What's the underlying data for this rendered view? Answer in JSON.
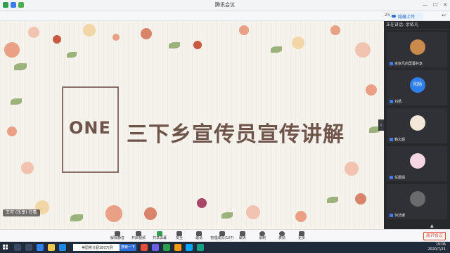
{
  "window": {
    "title": "腾讯会议"
  },
  "subbar": {
    "time": "25:08",
    "cloud_label": "隐藏上传"
  },
  "slide": {
    "title_en": "ONE",
    "title_cn": "三下乡宣传员宣传讲解",
    "speaker_tag": "王可 (乐享) 在看"
  },
  "panel": {
    "header": "正在讲话: 余依凡",
    "participants": [
      {
        "name": "余依凡的屏幕共享"
      },
      {
        "name": "阳扬",
        "avatar_text": "阳扬"
      },
      {
        "name": "刘扬"
      },
      {
        "name": "韩文超"
      },
      {
        "name": "任震娟"
      },
      {
        "name": "何法娜"
      }
    ],
    "collapse": "▲"
  },
  "toolbar": {
    "buttons": [
      {
        "label": "解除静音",
        "icon": "mic-icon"
      },
      {
        "label": "开启视频",
        "icon": "video-icon"
      },
      {
        "label": "共享屏幕",
        "icon": "share-screen-icon"
      },
      {
        "label": "安全",
        "icon": "shield-icon"
      },
      {
        "label": "邀请",
        "icon": "invite-icon"
      },
      {
        "label": "管理成员(107)",
        "icon": "members-icon"
      },
      {
        "label": "聊天",
        "icon": "chat-icon"
      },
      {
        "label": "录制",
        "icon": "record-icon"
      },
      {
        "label": "表情",
        "icon": "emoji-icon"
      },
      {
        "label": "更多",
        "icon": "more-icon"
      }
    ],
    "leave_label": "离开会议"
  },
  "taskbar": {
    "search_text": "美国累计超380万例",
    "search_button": "搜索一下",
    "time": "19:06",
    "date": "2020/7/21"
  },
  "colors": {
    "slide_text": "#6f5449",
    "accent_blue": "#2b6cd6",
    "leave_red": "#e74c3c"
  }
}
